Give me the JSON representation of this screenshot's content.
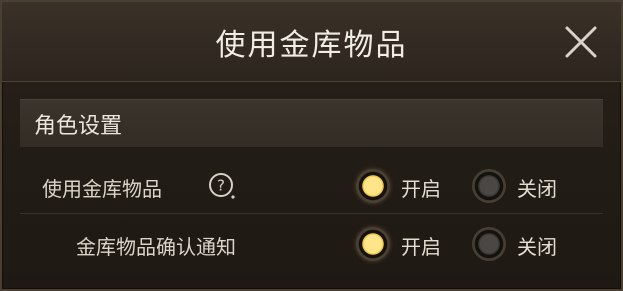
{
  "dialog": {
    "title": "使用金库物品",
    "close_icon": "close-icon"
  },
  "section": {
    "title": "角色设置"
  },
  "settings": [
    {
      "label": "使用金库物品",
      "has_help": true,
      "help_icon": "question-mark-icon",
      "on_label": "开启",
      "off_label": "关闭",
      "selected": "on"
    },
    {
      "label": "金库物品确认通知",
      "has_help": false,
      "on_label": "开启",
      "off_label": "关闭",
      "selected": "on"
    }
  ],
  "colors": {
    "accent_selected": "#f2c847",
    "text_primary": "#ece6dc"
  }
}
